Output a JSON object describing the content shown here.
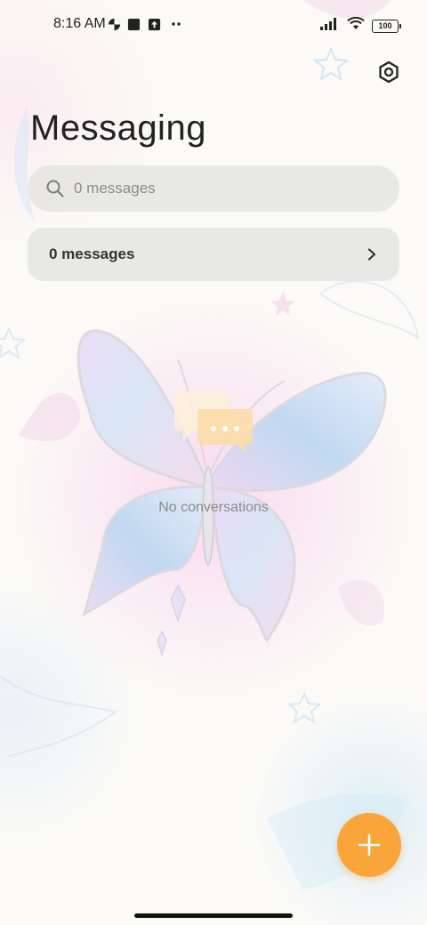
{
  "status_bar": {
    "time": "8:16 AM",
    "battery": "100",
    "notification_icons": [
      "pinwheel-icon",
      "square-app-icon",
      "upload-box-icon",
      "more-dots-icon"
    ],
    "right_icons": [
      "signal-icon",
      "wifi-icon",
      "battery-icon"
    ]
  },
  "header": {
    "title": "Messaging",
    "settings_icon": "settings-hexagon-icon"
  },
  "search": {
    "placeholder": "0 messages",
    "icon": "search-icon"
  },
  "summary": {
    "label": "0 messages",
    "icon": "chevron-right-icon"
  },
  "empty_state": {
    "text": "No conversations",
    "icon": "chat-bubbles-icon"
  },
  "fab": {
    "icon": "plus-icon",
    "color": "#f9a53a"
  },
  "theme": {
    "background": "#fbfaf7",
    "accent": "#f9a53a",
    "card": "#e4e4e1"
  }
}
